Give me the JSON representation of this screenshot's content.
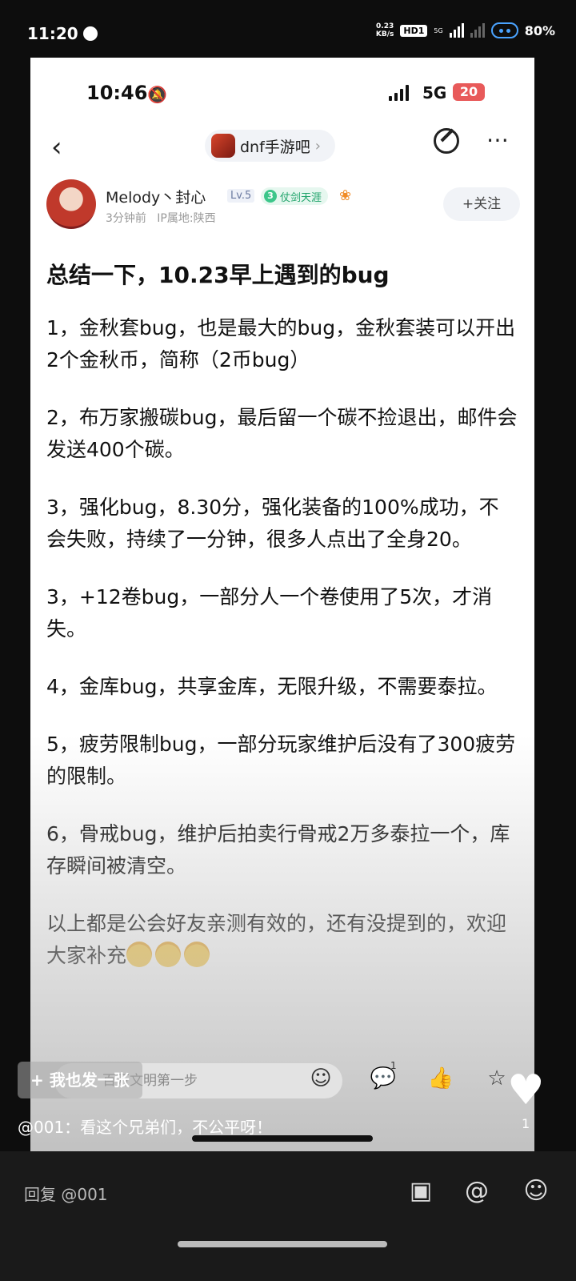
{
  "outer_status": {
    "time": "11:20",
    "net_speed_value": "0.23",
    "net_speed_unit": "KB/s",
    "hd_label": "HD1",
    "net_type_small": "5G",
    "battery": "80%"
  },
  "inner_status": {
    "time": "10:46",
    "network": "5G",
    "battery": "20"
  },
  "nav": {
    "back_icon": "chevron-left-icon",
    "forum_name": "dnf手游吧",
    "forum_chevron": "›",
    "edit_icon": "edit-icon",
    "more_icon": "⋯"
  },
  "author": {
    "name": "Melody丶封心",
    "level": "Lv.5",
    "title_badge_num": "3",
    "title_badge": "仗剑天涯",
    "time": "3分钟前",
    "ip": "IP属地:陕西",
    "follow_label": "+关注"
  },
  "post": {
    "title": "总结一下，10.23早上遇到的bug",
    "paragraphs": [
      "1，金秋套bug，也是最大的bug，金秋套装可以开出2个金秋币，简称（2币bug）",
      "2，布万家搬碳bug，最后留一个碳不捡退出，邮件会发送400个碳。",
      "3，强化bug，8.30分，强化装备的100%成功，不会失败，持续了一分钟，很多人点出了全身20。",
      "3，+12卷bug，一部分人一个卷使用了5次，才消失。",
      "4，金库bug，共享金库，无限升级，不需要泰拉。",
      "5，疲劳限制bug，一部分玩家维护后没有了300疲劳的限制。",
      "6，骨戒bug，维护后拍卖行骨戒2万多泰拉一个，库存瞬间被清空。",
      "以上都是公会好友亲测有效的，还有没提到的，欢迎大家补充"
    ]
  },
  "inner_bar": {
    "placeholder": "百万文明第一步",
    "comment_count": "1"
  },
  "overlay": {
    "share_label": "+ 我也发一张",
    "comment": "@001：看这个兄弟们，不公平呀！",
    "like_count": "1"
  },
  "reply_bar": {
    "placeholder": "回复 @001"
  }
}
